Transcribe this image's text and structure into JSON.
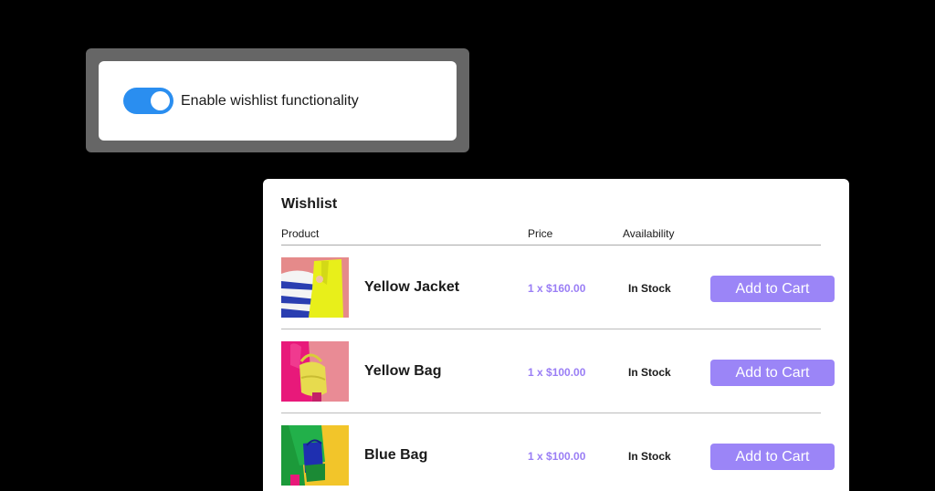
{
  "colors": {
    "toggle_on": "#2a8ef0",
    "price_accent": "#9a7ef5",
    "button_bg": "#9b85f7"
  },
  "settings": {
    "toggle_checked": true,
    "toggle_label": "Enable wishlist functionality"
  },
  "wishlist": {
    "title": "Wishlist",
    "columns": {
      "product": "Product",
      "price": "Price",
      "availability": "Availability"
    },
    "items": [
      {
        "name": "Yellow Jacket",
        "price": "1 x $160.00",
        "availability": "In Stock",
        "button": "Add to Cart",
        "image": "yellow-jacket-photo"
      },
      {
        "name": "Yellow Bag",
        "price": "1 x $100.00",
        "availability": "In Stock",
        "button": "Add to Cart",
        "image": "yellow-bag-photo"
      },
      {
        "name": "Blue Bag",
        "price": "1 x $100.00",
        "availability": "In Stock",
        "button": "Add to Cart",
        "image": "blue-bag-photo"
      }
    ]
  }
}
